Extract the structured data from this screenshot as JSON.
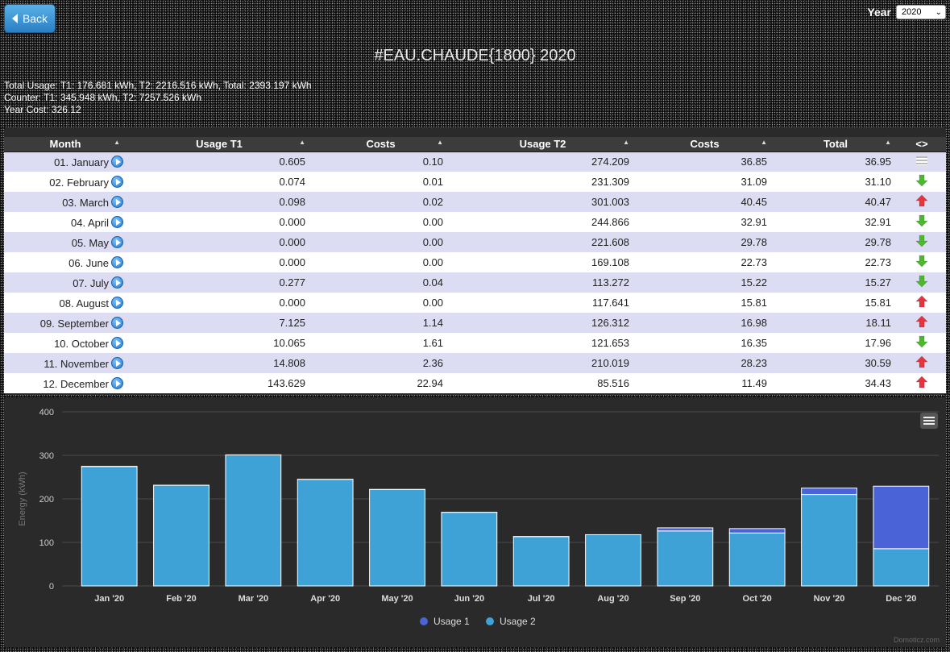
{
  "header": {
    "back_label": "Back",
    "year_label": "Year",
    "year_value": "2020",
    "title": "#EAU.CHAUDE{1800} 2020"
  },
  "summary": {
    "line1": "Total Usage: T1: 176.681 kWh, T2: 2216.516 kWh, Total: 2393.197 kWh",
    "line2": "Counter: T1: 345.948 kWh, T2: 7257.526 kWh",
    "line3": "Year Cost: 326.12"
  },
  "table": {
    "columns": [
      "Month",
      "Usage T1",
      "Costs",
      "Usage T2",
      "Costs",
      "Total",
      "<>"
    ],
    "rows": [
      {
        "month": "01. January",
        "t1": "0.605",
        "c1": "0.10",
        "t2": "274.209",
        "c2": "36.85",
        "total": "36.95",
        "trend": "equal"
      },
      {
        "month": "02. February",
        "t1": "0.074",
        "c1": "0.01",
        "t2": "231.309",
        "c2": "31.09",
        "total": "31.10",
        "trend": "down"
      },
      {
        "month": "03. March",
        "t1": "0.098",
        "c1": "0.02",
        "t2": "301.003",
        "c2": "40.45",
        "total": "40.47",
        "trend": "up"
      },
      {
        "month": "04. April",
        "t1": "0.000",
        "c1": "0.00",
        "t2": "244.866",
        "c2": "32.91",
        "total": "32.91",
        "trend": "down"
      },
      {
        "month": "05. May",
        "t1": "0.000",
        "c1": "0.00",
        "t2": "221.608",
        "c2": "29.78",
        "total": "29.78",
        "trend": "down"
      },
      {
        "month": "06. June",
        "t1": "0.000",
        "c1": "0.00",
        "t2": "169.108",
        "c2": "22.73",
        "total": "22.73",
        "trend": "down"
      },
      {
        "month": "07. July",
        "t1": "0.277",
        "c1": "0.04",
        "t2": "113.272",
        "c2": "15.22",
        "total": "15.27",
        "trend": "down"
      },
      {
        "month": "08. August",
        "t1": "0.000",
        "c1": "0.00",
        "t2": "117.641",
        "c2": "15.81",
        "total": "15.81",
        "trend": "up"
      },
      {
        "month": "09. September",
        "t1": "7.125",
        "c1": "1.14",
        "t2": "126.312",
        "c2": "16.98",
        "total": "18.11",
        "trend": "up"
      },
      {
        "month": "10. October",
        "t1": "10.065",
        "c1": "1.61",
        "t2": "121.653",
        "c2": "16.35",
        "total": "17.96",
        "trend": "down"
      },
      {
        "month": "11. November",
        "t1": "14.808",
        "c1": "2.36",
        "t2": "210.019",
        "c2": "28.23",
        "total": "30.59",
        "trend": "up"
      },
      {
        "month": "12. December",
        "t1": "143.629",
        "c1": "22.94",
        "t2": "85.516",
        "c2": "11.49",
        "total": "34.43",
        "trend": "up"
      }
    ]
  },
  "colors": {
    "usage1": "#4a63d6",
    "usage2": "#3ea2d6",
    "arrow_up": "#e8333f",
    "arrow_down": "#4cb82e"
  },
  "chart_data": {
    "type": "bar",
    "stacked": true,
    "categories": [
      "Jan '20",
      "Feb '20",
      "Mar '20",
      "Apr '20",
      "May '20",
      "Jun '20",
      "Jul '20",
      "Aug '20",
      "Sep '20",
      "Oct '20",
      "Nov '20",
      "Dec '20"
    ],
    "series": [
      {
        "name": "Usage 1",
        "values": [
          0.605,
          0.074,
          0.098,
          0.0,
          0.0,
          0.0,
          0.277,
          0.0,
          7.125,
          10.065,
          14.808,
          143.629
        ]
      },
      {
        "name": "Usage 2",
        "values": [
          274.209,
          231.309,
          301.003,
          244.866,
          221.608,
          169.108,
          113.272,
          117.641,
          126.312,
          121.653,
          210.019,
          85.516
        ]
      }
    ],
    "ylabel": "Energy (kWh)",
    "yticks": [
      0,
      100,
      200,
      300,
      400
    ],
    "ylim": [
      0,
      400
    ],
    "grid": true,
    "legend": "bottom-center",
    "credit": "Domoticz.com"
  }
}
